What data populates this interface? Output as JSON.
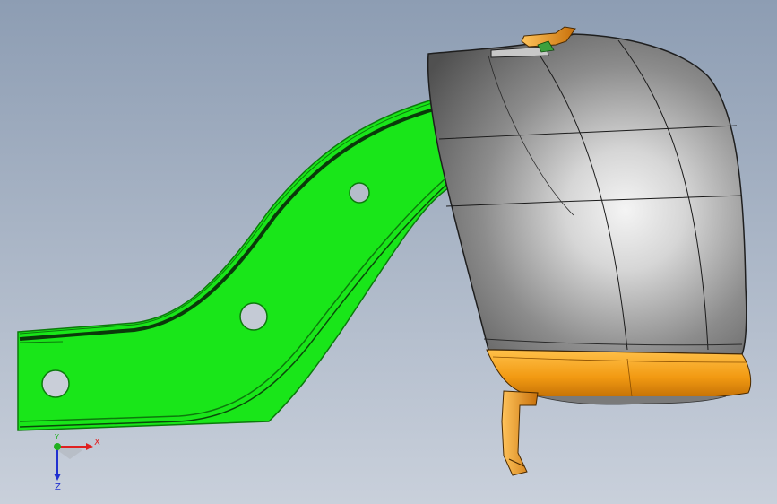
{
  "viewport": {
    "background_top": "#8d9db3",
    "background_bottom": "#c9d0db"
  },
  "model": {
    "bracket_color": "#19e619",
    "bracket_edge_color": "#0c7a0c",
    "housing_color": "#8a8a8a",
    "housing_highlight": "#f2f2f2",
    "lower_trim_color": "#f29a12",
    "clip_color": "#e88a10"
  },
  "triad": {
    "x_label": "X",
    "y_label": "Y",
    "z_label": "Z",
    "x_color": "#e02020",
    "y_color": "#20b020",
    "z_color": "#2030d0"
  }
}
